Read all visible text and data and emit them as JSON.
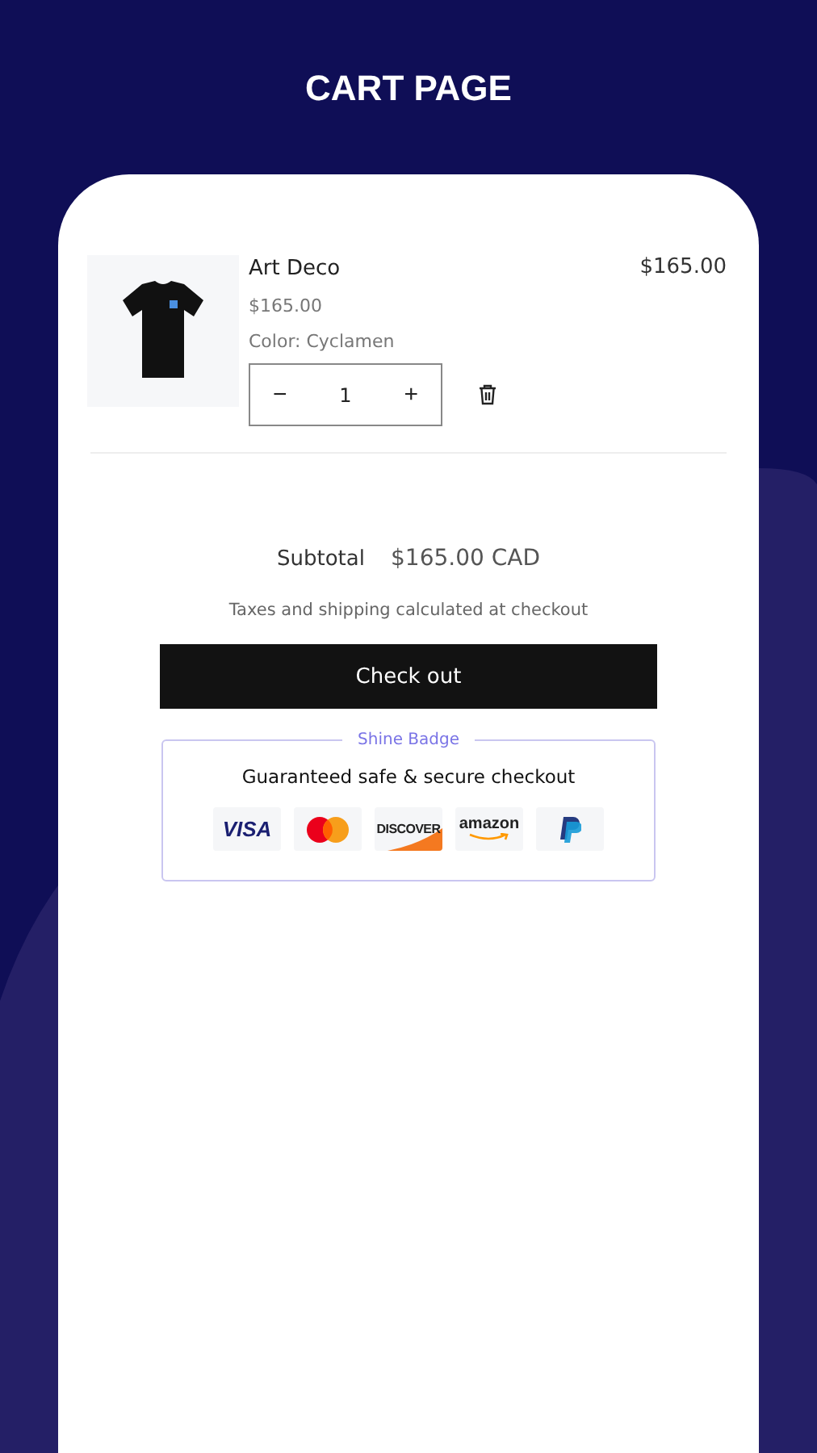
{
  "header": {
    "title": "CART PAGE"
  },
  "cart_item": {
    "kind": "picture",
    "name": "Art Deco",
    "unit_price": "$165.00",
    "variant": "Color: Cyclamen",
    "quantity": "1",
    "decrease": "−",
    "increase": "+",
    "line_total": "$165.00"
  },
  "summary": {
    "subtotal_label": "Subtotal",
    "subtotal_value": "$165.00 CAD",
    "note": "Taxes and shipping calculated at checkout",
    "checkout_button": "Check out"
  },
  "badge": {
    "legend": "Shine Badge",
    "heading": "Guaranteed safe & secure checkout",
    "payment_methods": [
      {
        "kind": "visa",
        "label": "VISA"
      },
      {
        "kind": "mastercard"
      },
      {
        "kind": "discover",
        "label": "DISCOVER"
      },
      {
        "kind": "amazon",
        "label": "amazon"
      },
      {
        "kind": "paypal"
      }
    ]
  }
}
